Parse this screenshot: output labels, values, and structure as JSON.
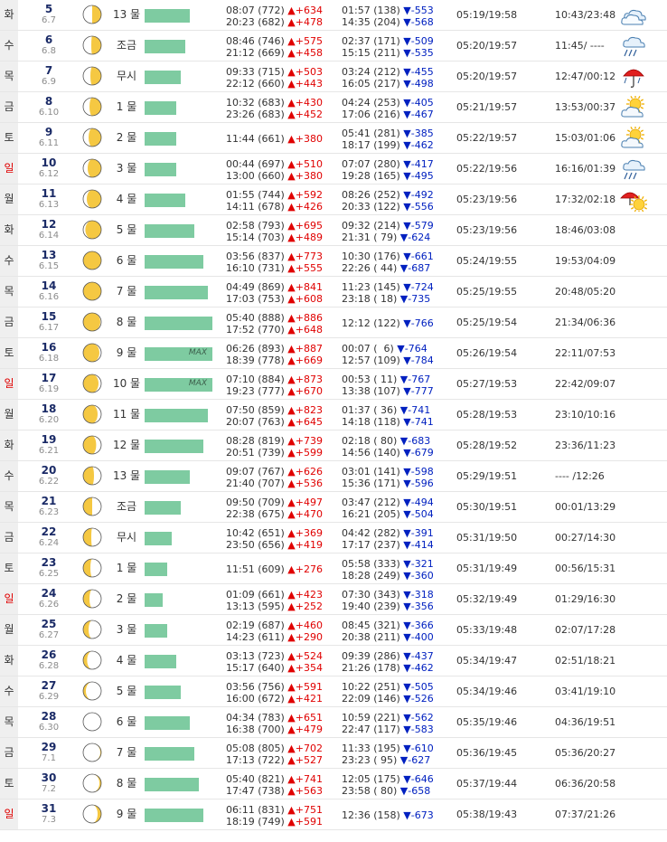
{
  "rows": [
    {
      "day": "화",
      "date": "5",
      "lunar": "6.7",
      "tide": "13 물",
      "bar": 50,
      "max": false,
      "h1": "08:07 (772) ",
      "h1d": "▲+634",
      "h2": "20:23 (682) ",
      "h2d": "▲+478",
      "l1": "01:57 (138) ",
      "l1d": "▼-553",
      "l2": "14:35 (204) ",
      "l2d": "▼-568",
      "sun": "05:19/19:58",
      "moon": "10:43/23:48",
      "weather": "cloud-icon",
      "phase": {
        "type": "first",
        "lit": 0.5
      }
    },
    {
      "day": "수",
      "date": "6",
      "lunar": "6.8",
      "tide": "조금",
      "bar": 45,
      "max": false,
      "h1": "08:46 (746) ",
      "h1d": "▲+575",
      "h2": "21:12 (669) ",
      "h2d": "▲+458",
      "l1": "02:37 (171) ",
      "l1d": "▼-509",
      "l2": "15:15 (211) ",
      "l2d": "▼-535",
      "sun": "05:20/19:57",
      "moon": "11:45/ ----",
      "weather": "rain-cloud-icon",
      "phase": {
        "type": "first",
        "lit": 0.55
      }
    },
    {
      "day": "목",
      "date": "7",
      "lunar": "6.9",
      "tide": "무시",
      "bar": 40,
      "max": false,
      "h1": "09:33 (715) ",
      "h1d": "▲+503",
      "h2": "22:12 (660) ",
      "h2d": "▲+443",
      "l1": "03:24 (212) ",
      "l1d": "▼-455",
      "l2": "16:05 (217) ",
      "l2d": "▼-498",
      "sun": "05:20/19:57",
      "moon": "12:47/00:12",
      "weather": "umbrella-icon",
      "phase": {
        "type": "first",
        "lit": 0.6
      }
    },
    {
      "day": "금",
      "date": "8",
      "lunar": "6.10",
      "tide": "1 물",
      "bar": 35,
      "max": false,
      "h1": "10:32 (683) ",
      "h1d": "▲+430",
      "h2": "23:26 (683) ",
      "h2d": "▲+452",
      "l1": "04:24 (253) ",
      "l1d": "▼-405",
      "l2": "17:06 (216) ",
      "l2d": "▼-467",
      "sun": "05:21/19:57",
      "moon": "13:53/00:37",
      "weather": "sun-cloud-icon",
      "phase": {
        "type": "first",
        "lit": 0.65
      }
    },
    {
      "day": "토",
      "date": "9",
      "lunar": "6.11",
      "tide": "2 물",
      "bar": 35,
      "max": false,
      "h1": "11:44 (661) ",
      "h1d": "▲+380",
      "h2": "",
      "h2d": "",
      "l1": "05:41 (281) ",
      "l1d": "▼-385",
      "l2": "18:17 (199) ",
      "l2d": "▼-462",
      "sun": "05:22/19:57",
      "moon": "15:03/01:06",
      "weather": "sun-cloud-icon",
      "phase": {
        "type": "first",
        "lit": 0.7
      }
    },
    {
      "day": "일",
      "date": "10",
      "lunar": "6.12",
      "tide": "3 물",
      "bar": 35,
      "max": false,
      "h1": "00:44 (697) ",
      "h1d": "▲+510",
      "h2": "13:00 (660) ",
      "h2d": "▲+380",
      "l1": "07:07 (280) ",
      "l1d": "▼-417",
      "l2": "19:28 (165) ",
      "l2d": "▼-495",
      "sun": "05:22/19:56",
      "moon": "16:16/01:39",
      "weather": "rain-cloud-icon",
      "phase": {
        "type": "first",
        "lit": 0.75
      }
    },
    {
      "day": "월",
      "date": "11",
      "lunar": "6.13",
      "tide": "4 물",
      "bar": 45,
      "max": false,
      "h1": "01:55 (744) ",
      "h1d": "▲+592",
      "h2": "14:11 (678) ",
      "h2d": "▲+426",
      "l1": "08:26 (252) ",
      "l1d": "▼-492",
      "l2": "20:33 (122) ",
      "l2d": "▼-556",
      "sun": "05:23/19:56",
      "moon": "17:32/02:18",
      "weather": "umbrella-sun-icon",
      "phase": {
        "type": "first",
        "lit": 0.8
      }
    },
    {
      "day": "화",
      "date": "12",
      "lunar": "6.14",
      "tide": "5 물",
      "bar": 55,
      "max": false,
      "h1": "02:58 (793) ",
      "h1d": "▲+695",
      "h2": "15:14 (703) ",
      "h2d": "▲+489",
      "l1": "09:32 (214) ",
      "l1d": "▼-579",
      "l2": "21:31 ( 79) ",
      "l2d": "▼-624",
      "sun": "05:23/19:56",
      "moon": "18:46/03:08",
      "weather": "",
      "phase": {
        "type": "first",
        "lit": 0.88
      }
    },
    {
      "day": "수",
      "date": "13",
      "lunar": "6.15",
      "tide": "6 물",
      "bar": 65,
      "max": false,
      "h1": "03:56 (837) ",
      "h1d": "▲+773",
      "h2": "16:10 (731) ",
      "h2d": "▲+555",
      "l1": "10:30 (176) ",
      "l1d": "▼-661",
      "l2": "22:26 ( 44) ",
      "l2d": "▼-687",
      "sun": "05:24/19:55",
      "moon": "19:53/04:09",
      "weather": "",
      "phase": {
        "type": "full",
        "lit": 1
      }
    },
    {
      "day": "목",
      "date": "14",
      "lunar": "6.16",
      "tide": "7 물",
      "bar": 70,
      "max": false,
      "h1": "04:49 (869) ",
      "h1d": "▲+841",
      "h2": "17:03 (753) ",
      "h2d": "▲+608",
      "l1": "11:23 (145) ",
      "l1d": "▼-724",
      "l2": "23:18 ( 18) ",
      "l2d": "▼-735",
      "sun": "05:25/19:55",
      "moon": "20:48/05:20",
      "weather": "",
      "phase": {
        "type": "full",
        "lit": 1
      }
    },
    {
      "day": "금",
      "date": "15",
      "lunar": "6.17",
      "tide": "8 물",
      "bar": 75,
      "max": false,
      "h1": "05:40 (888) ",
      "h1d": "▲+886",
      "h2": "17:52 (770) ",
      "h2d": "▲+648",
      "l1": "12:12 (122) ",
      "l1d": "▼-766",
      "l2": "",
      "l2d": "",
      "sun": "05:25/19:54",
      "moon": "21:34/06:36",
      "weather": "",
      "phase": {
        "type": "last",
        "lit": 0.95
      }
    },
    {
      "day": "토",
      "date": "16",
      "lunar": "6.18",
      "tide": "9 물",
      "bar": 75,
      "max": true,
      "h1": "06:26 (893) ",
      "h1d": "▲+887",
      "h2": "18:39 (778) ",
      "h2d": "▲+669",
      "l1": "00:07 (  6) ",
      "l1d": "▼-764",
      "l2": "12:57 (109) ",
      "l2d": "▼-784",
      "sun": "05:26/19:54",
      "moon": "22:11/07:53",
      "weather": "",
      "phase": {
        "type": "last",
        "lit": 0.9
      }
    },
    {
      "day": "일",
      "date": "17",
      "lunar": "6.19",
      "tide": "10 물",
      "bar": 75,
      "max": true,
      "h1": "07:10 (884) ",
      "h1d": "▲+873",
      "h2": "19:23 (777) ",
      "h2d": "▲+670",
      "l1": "00:53 ( 11) ",
      "l1d": "▼-767",
      "l2": "13:38 (107) ",
      "l2d": "▼-777",
      "sun": "05:27/19:53",
      "moon": "22:42/09:07",
      "weather": "",
      "phase": {
        "type": "last",
        "lit": 0.85
      }
    },
    {
      "day": "월",
      "date": "18",
      "lunar": "6.20",
      "tide": "11 물",
      "bar": 70,
      "max": false,
      "h1": "07:50 (859) ",
      "h1d": "▲+823",
      "h2": "20:07 (763) ",
      "h2d": "▲+645",
      "l1": "01:37 ( 36) ",
      "l1d": "▼-741",
      "l2": "14:18 (118) ",
      "l2d": "▼-741",
      "sun": "05:28/19:53",
      "moon": "23:10/10:16",
      "weather": "",
      "phase": {
        "type": "last",
        "lit": 0.8
      }
    },
    {
      "day": "화",
      "date": "19",
      "lunar": "6.21",
      "tide": "12 물",
      "bar": 65,
      "max": false,
      "h1": "08:28 (819) ",
      "h1d": "▲+739",
      "h2": "20:51 (739) ",
      "h2d": "▲+599",
      "l1": "02:18 ( 80) ",
      "l1d": "▼-683",
      "l2": "14:56 (140) ",
      "l2d": "▼-679",
      "sun": "05:28/19:52",
      "moon": "23:36/11:23",
      "weather": "",
      "phase": {
        "type": "last",
        "lit": 0.72
      }
    },
    {
      "day": "수",
      "date": "20",
      "lunar": "6.22",
      "tide": "13 물",
      "bar": 50,
      "max": false,
      "h1": "09:07 (767) ",
      "h1d": "▲+626",
      "h2": "21:40 (707) ",
      "h2d": "▲+536",
      "l1": "03:01 (141) ",
      "l1d": "▼-598",
      "l2": "15:36 (171) ",
      "l2d": "▼-596",
      "sun": "05:29/19:51",
      "moon": "---- /12:26",
      "weather": "",
      "phase": {
        "type": "last",
        "lit": 0.6
      }
    },
    {
      "day": "목",
      "date": "21",
      "lunar": "6.23",
      "tide": "조금",
      "bar": 40,
      "max": false,
      "h1": "09:50 (709) ",
      "h1d": "▲+497",
      "h2": "22:38 (675) ",
      "h2d": "▲+470",
      "l1": "03:47 (212) ",
      "l1d": "▼-494",
      "l2": "16:21 (205) ",
      "l2d": "▼-504",
      "sun": "05:30/19:51",
      "moon": "00:01/13:29",
      "weather": "",
      "phase": {
        "type": "last",
        "lit": 0.5
      }
    },
    {
      "day": "금",
      "date": "22",
      "lunar": "6.24",
      "tide": "무시",
      "bar": 30,
      "max": false,
      "h1": "10:42 (651) ",
      "h1d": "▲+369",
      "h2": "23:50 (656) ",
      "h2d": "▲+419",
      "l1": "04:42 (282) ",
      "l1d": "▼-391",
      "l2": "17:17 (237) ",
      "l2d": "▼-414",
      "sun": "05:31/19:50",
      "moon": "00:27/14:30",
      "weather": "",
      "phase": {
        "type": "last",
        "lit": 0.45
      }
    },
    {
      "day": "토",
      "date": "23",
      "lunar": "6.25",
      "tide": "1 물",
      "bar": 25,
      "max": false,
      "h1": "11:51 (609) ",
      "h1d": "▲+276",
      "h2": "",
      "h2d": "",
      "l1": "05:58 (333) ",
      "l1d": "▼-321",
      "l2": "18:28 (249) ",
      "l2d": "▼-360",
      "sun": "05:31/19:49",
      "moon": "00:56/15:31",
      "weather": "",
      "phase": {
        "type": "last",
        "lit": 0.4
      }
    },
    {
      "day": "일",
      "date": "24",
      "lunar": "6.26",
      "tide": "2 물",
      "bar": 20,
      "max": false,
      "h1": "01:09 (661) ",
      "h1d": "▲+423",
      "h2": "13:13 (595) ",
      "h2d": "▲+252",
      "l1": "07:30 (343) ",
      "l1d": "▼-318",
      "l2": "19:40 (239) ",
      "l2d": "▼-356",
      "sun": "05:32/19:49",
      "moon": "01:29/16:30",
      "weather": "",
      "phase": {
        "type": "last",
        "lit": 0.35
      }
    },
    {
      "day": "월",
      "date": "25",
      "lunar": "6.27",
      "tide": "3 물",
      "bar": 25,
      "max": false,
      "h1": "02:19 (687) ",
      "h1d": "▲+460",
      "h2": "14:23 (611) ",
      "h2d": "▲+290",
      "l1": "08:45 (321) ",
      "l1d": "▼-366",
      "l2": "20:38 (211) ",
      "l2d": "▼-400",
      "sun": "05:33/19:48",
      "moon": "02:07/17:28",
      "weather": "",
      "phase": {
        "type": "last",
        "lit": 0.3
      }
    },
    {
      "day": "화",
      "date": "26",
      "lunar": "6.28",
      "tide": "4 물",
      "bar": 35,
      "max": false,
      "h1": "03:13 (723) ",
      "h1d": "▲+524",
      "h2": "15:17 (640) ",
      "h2d": "▲+354",
      "l1": "09:39 (286) ",
      "l1d": "▼-437",
      "l2": "21:26 (178) ",
      "l2d": "▼-462",
      "sun": "05:34/19:47",
      "moon": "02:51/18:21",
      "weather": "",
      "phase": {
        "type": "last",
        "lit": 0.22
      }
    },
    {
      "day": "수",
      "date": "27",
      "lunar": "6.29",
      "tide": "5 물",
      "bar": 40,
      "max": false,
      "h1": "03:56 (756) ",
      "h1d": "▲+591",
      "h2": "16:00 (672) ",
      "h2d": "▲+421",
      "l1": "10:22 (251) ",
      "l1d": "▼-505",
      "l2": "22:09 (146) ",
      "l2d": "▼-526",
      "sun": "05:34/19:46",
      "moon": "03:41/19:10",
      "weather": "",
      "phase": {
        "type": "last",
        "lit": 0.15
      }
    },
    {
      "day": "목",
      "date": "28",
      "lunar": "6.30",
      "tide": "6 물",
      "bar": 50,
      "max": false,
      "h1": "04:34 (783) ",
      "h1d": "▲+651",
      "h2": "16:38 (700) ",
      "h2d": "▲+479",
      "l1": "10:59 (221) ",
      "l1d": "▼-562",
      "l2": "22:47 (117) ",
      "l2d": "▼-583",
      "sun": "05:35/19:46",
      "moon": "04:36/19:51",
      "weather": "",
      "phase": {
        "type": "new",
        "lit": 0
      }
    },
    {
      "day": "금",
      "date": "29",
      "lunar": "7.1",
      "tide": "7 물",
      "bar": 55,
      "max": false,
      "h1": "05:08 (805) ",
      "h1d": "▲+702",
      "h2": "17:13 (722) ",
      "h2d": "▲+527",
      "l1": "11:33 (195) ",
      "l1d": "▼-610",
      "l2": "23:23 ( 95) ",
      "l2d": "▼-627",
      "sun": "05:36/19:45",
      "moon": "05:36/20:27",
      "weather": "",
      "phase": {
        "type": "new-thin",
        "lit": 0.05
      }
    },
    {
      "day": "토",
      "date": "30",
      "lunar": "7.2",
      "tide": "8 물",
      "bar": 60,
      "max": false,
      "h1": "05:40 (821) ",
      "h1d": "▲+741",
      "h2": "17:47 (738) ",
      "h2d": "▲+563",
      "l1": "12:05 (175) ",
      "l1d": "▼-646",
      "l2": "23:58 ( 80) ",
      "l2d": "▼-658",
      "sun": "05:37/19:44",
      "moon": "06:36/20:58",
      "weather": "",
      "phase": {
        "type": "first",
        "lit": 0.1
      }
    },
    {
      "day": "일",
      "date": "31",
      "lunar": "7.3",
      "tide": "9 물",
      "bar": 65,
      "max": false,
      "h1": "06:11 (831) ",
      "h1d": "▲+751",
      "h2": "18:19 (749) ",
      "h2d": "▲+591",
      "l1": "12:36 (158) ",
      "l1d": "▼-673",
      "l2": "",
      "l2d": "",
      "sun": "05:38/19:43",
      "moon": "07:37/21:26",
      "weather": "",
      "phase": {
        "type": "first",
        "lit": 0.2
      }
    }
  ],
  "max_label": "MAX",
  "colors": {
    "bar": "#7ecba1",
    "moon": "#f5c842",
    "up": "#e00000",
    "down": "#0020c0",
    "sunday": "#e00000"
  }
}
